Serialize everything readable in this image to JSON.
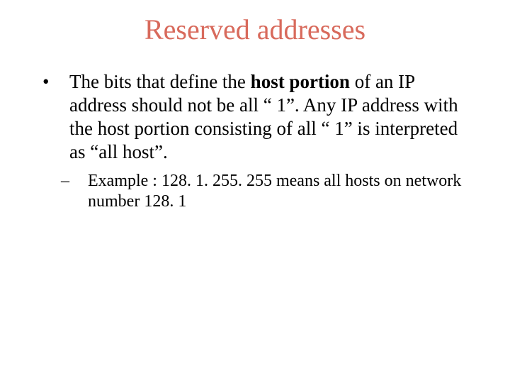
{
  "title": "Reserved addresses",
  "bullet": {
    "marker": "•",
    "text_before_bold": "The bits that define the ",
    "bold": "host portion",
    "text_after_bold": " of an IP address should not be all “ 1”.  Any IP address with the host portion consisting of all “ 1” is interpreted as “all host”."
  },
  "sub": {
    "marker": "–",
    "text": "Example :  128. 1. 255. 255 means all hosts on network number 128. 1"
  }
}
